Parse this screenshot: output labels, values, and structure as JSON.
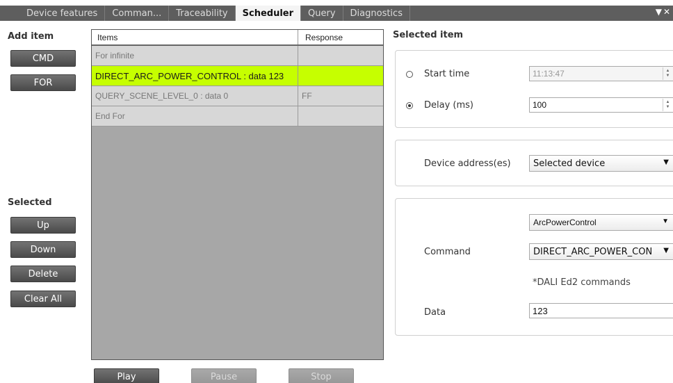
{
  "tabs": [
    {
      "label": "Device features",
      "active": false
    },
    {
      "label": "Comman...",
      "active": false
    },
    {
      "label": "Traceability",
      "active": false
    },
    {
      "label": "Scheduler",
      "active": true
    },
    {
      "label": "Query",
      "active": false
    },
    {
      "label": "Diagnostics",
      "active": false
    }
  ],
  "left": {
    "add_item_title": "Add item",
    "cmd_label": "CMD",
    "for_label": "FOR",
    "selected_title": "Selected",
    "up_label": "Up",
    "down_label": "Down",
    "delete_label": "Delete",
    "clear_all_label": "Clear All"
  },
  "grid": {
    "col_items": "Items",
    "col_response": "Response",
    "rows": [
      {
        "item": "For infinite",
        "response": "",
        "selected": false
      },
      {
        "item": "DIRECT_ARC_POWER_CONTROL : data 123",
        "response": "",
        "selected": true
      },
      {
        "item": "QUERY_SCENE_LEVEL_0 : data 0",
        "response": "FF",
        "selected": false
      },
      {
        "item": "End For",
        "response": "",
        "selected": false
      }
    ]
  },
  "playback": {
    "play_label": "Play",
    "pause_label": "Pause",
    "stop_label": "Stop"
  },
  "selected_item": {
    "title": "Selected item",
    "start_time_label": "Start time",
    "start_time_value": "11:13:47",
    "start_time_checked": false,
    "delay_label": "Delay (ms)",
    "delay_value": "100",
    "delay_checked": true,
    "device_address_label": "Device address(es)",
    "device_address_value": "Selected device",
    "command_group_value": "ArcPowerControl",
    "command_label": "Command",
    "command_value": "DIRECT_ARC_POWER_CON",
    "note": "*DALI Ed2 commands",
    "data_label": "Data",
    "data_value": "123"
  }
}
